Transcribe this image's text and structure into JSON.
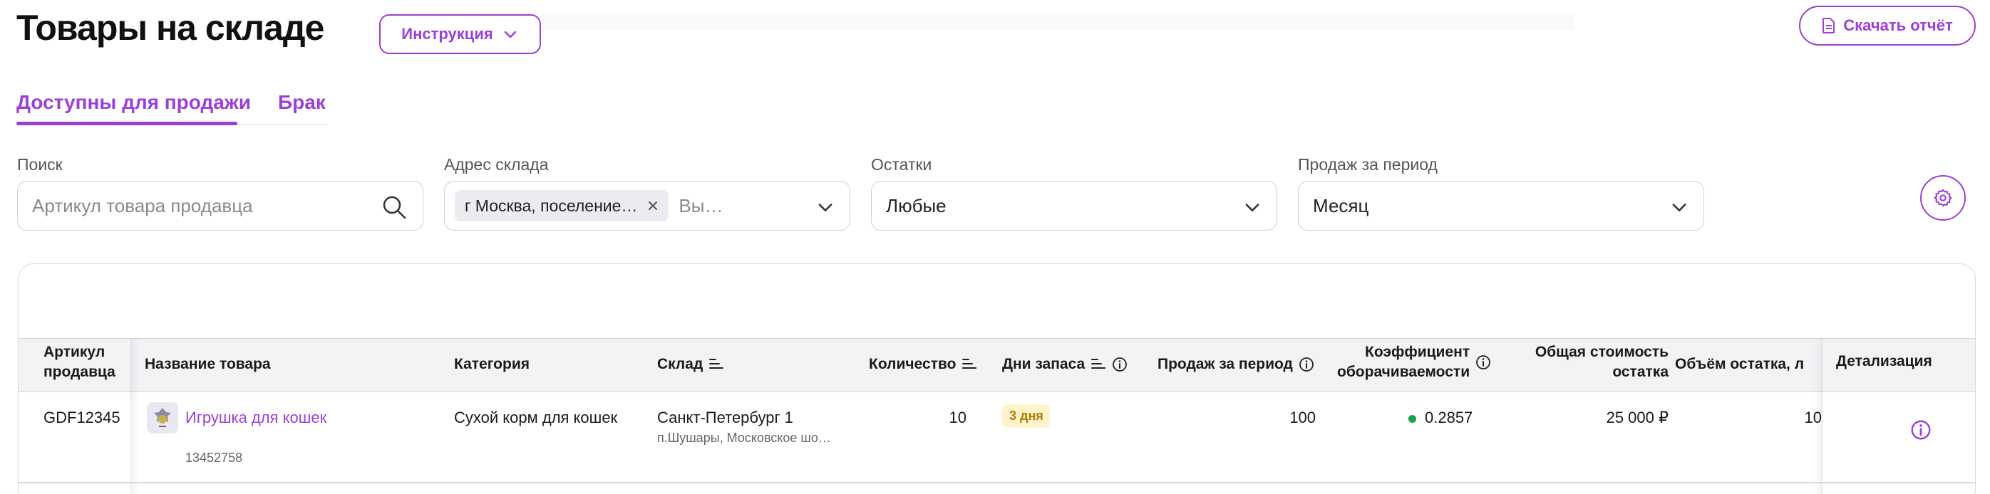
{
  "header": {
    "title": "Товары на складе",
    "instruction_label": "Инструкция",
    "download_label": "Скачать отчёт"
  },
  "tabs": [
    {
      "label": "Доступны для продажи",
      "active": true
    },
    {
      "label": "Брак",
      "active": false
    }
  ],
  "filters": {
    "search": {
      "label": "Поиск",
      "placeholder": "Артикул товара продавца"
    },
    "warehouse": {
      "label": "Адрес склада",
      "chip": "г Москва, поселение…",
      "placeholder": "Вы…"
    },
    "stock": {
      "label": "Остатки",
      "value": "Любые"
    },
    "period": {
      "label": "Продаж за период",
      "value": "Месяц"
    }
  },
  "table": {
    "columns": {
      "article": [
        "Артикул",
        "продавца"
      ],
      "name": "Название товара",
      "category": "Категория",
      "warehouse": "Склад",
      "quantity": "Количество",
      "days": "Дни запаса",
      "sales": "Продаж за период",
      "turnover": [
        "Коэффициент",
        "оборачиваемости"
      ],
      "total_cost": [
        "Общая стоимость",
        "остатка"
      ],
      "volume": "Объём остатка, л",
      "details": "Детализация"
    },
    "rows": [
      {
        "article": "GDF12345",
        "name": "Игрушка для кошек",
        "sku": "13452758",
        "category": "Сухой корм для кошек",
        "warehouse": "Санкт-Петербург 1",
        "warehouse_address": "п.Шушары, Московское шо…",
        "quantity": "10",
        "days": "3 дня",
        "sales": "100",
        "turnover": "0.2857",
        "total_cost": "25 000 ₽",
        "volume": "10"
      }
    ]
  },
  "colors": {
    "accent": "#9b3fd6",
    "status_ok": "#1aa34a",
    "badge_bg": "#fff4cc",
    "badge_text": "#b07a00"
  }
}
